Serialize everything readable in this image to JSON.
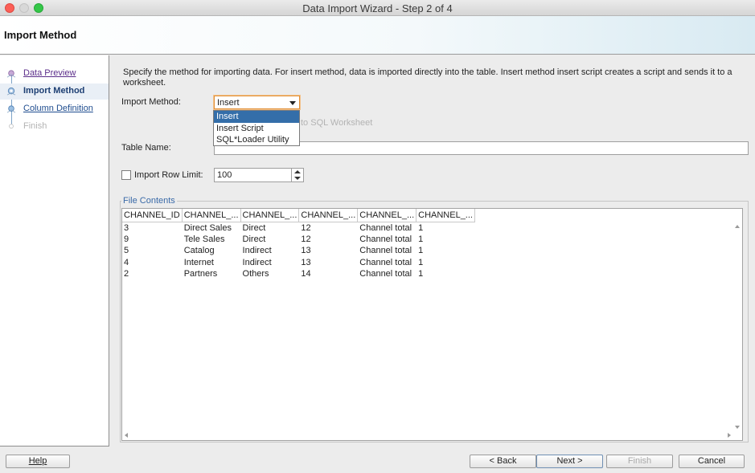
{
  "window": {
    "title": "Data Import Wizard - Step 2 of 4"
  },
  "header": {
    "title": "Import Method"
  },
  "nav": {
    "items": [
      {
        "label": "Data Preview",
        "state": "visited"
      },
      {
        "label": "Import Method",
        "state": "current"
      },
      {
        "label": "Column Definition",
        "state": "link"
      },
      {
        "label": "Finish",
        "state": "disabled"
      }
    ]
  },
  "main": {
    "description": "Specify the method for importing data.  For insert method, data is imported directly into the table.  Insert method insert script creates a script and sends it to a worksheet.",
    "import_method": {
      "label": "Import Method:",
      "value": "Insert",
      "options": [
        "Insert",
        "Insert Script",
        "SQL*Loader Utility"
      ],
      "selected_index": 0
    },
    "send_to_worksheet_label": "to SQL Worksheet",
    "table_name": {
      "label": "Table Name:",
      "value": ""
    },
    "row_limit": {
      "label": "Import Row Limit:",
      "checked": false,
      "value": "100"
    },
    "file_contents": {
      "legend": "File Contents",
      "columns": [
        "CHANNEL_ID",
        "CHANNEL_...",
        "CHANNEL_...",
        "CHANNEL_...",
        "CHANNEL_...",
        "CHANNEL_..."
      ],
      "rows": [
        [
          "3",
          "Direct Sales",
          "Direct",
          "12",
          "Channel total",
          "1"
        ],
        [
          "9",
          "Tele Sales",
          "Direct",
          "12",
          "Channel total",
          "1"
        ],
        [
          "5",
          "Catalog",
          "Indirect",
          "13",
          "Channel total",
          "1"
        ],
        [
          "4",
          "Internet",
          "Indirect",
          "13",
          "Channel total",
          "1"
        ],
        [
          "2",
          "Partners",
          "Others",
          "14",
          "Channel total",
          "1"
        ]
      ]
    }
  },
  "buttons": {
    "help": "Help",
    "back": "< Back",
    "next": "Next >",
    "finish": "Finish",
    "cancel": "Cancel"
  },
  "colors": {
    "accent": "#346ea9",
    "focus_ring": "#e28f35",
    "link": "#5b2d8a"
  }
}
